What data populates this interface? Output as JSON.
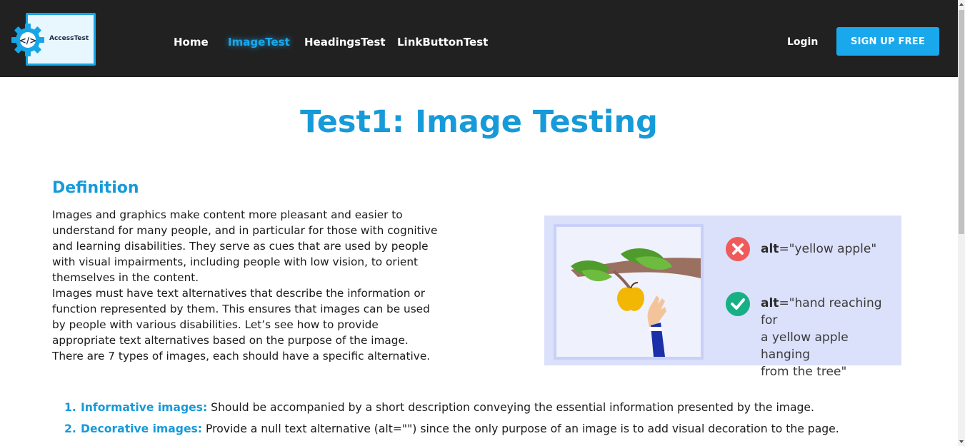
{
  "brand": {
    "logo_text": "AccessTest"
  },
  "nav": {
    "links": [
      {
        "label": "Home",
        "active": false
      },
      {
        "label": "ImageTest",
        "active": true
      },
      {
        "label": "HeadingsTest",
        "active": false
      },
      {
        "label": "LinkButtonTest",
        "active": false
      }
    ],
    "login_label": "Login",
    "signup_label": "SIGN UP FREE"
  },
  "page": {
    "title": "Test1: Image Testing",
    "definition_heading": "Definition",
    "definition_paragraphs": [
      "Images and graphics make content more pleasant and easier to understand for many people, and in particular for those with cognitive and learning disabilities. They serve as cues that are used by people with visual impairments, including people with low vision, to orient themselves in the content.",
      "Images must have text alternatives that describe the information or function represented by them. This ensures that images can be used by people with various disabilities. Let’s see how to provide appropriate text alternatives based on the purpose of the image. There are 7 types of images, each should have a specific alternative."
    ]
  },
  "illustration": {
    "bad_alt_keyword": "alt",
    "bad_alt_value": "=\"yellow apple\"",
    "good_alt_keyword": "alt",
    "good_alt_line1": "=\"hand reaching for",
    "good_alt_line2": "a yellow apple hanging",
    "good_alt_line3": "from the tree\""
  },
  "image_types": [
    {
      "number": "1.",
      "term": "Informative images:",
      "description": " Should be accompanied by a short description conveying the essential information presented by the image."
    },
    {
      "number": "2.",
      "term": "Decorative images:",
      "description": " Provide a null text alternative (alt=\"\") since the only purpose of an image is to add visual decoration to the page."
    }
  ],
  "colors": {
    "navbar_bg": "#212121",
    "accent": "#1aa8ec",
    "heading": "#169ad9",
    "bad_badge": "#f05a5a",
    "good_badge": "#17b085"
  }
}
